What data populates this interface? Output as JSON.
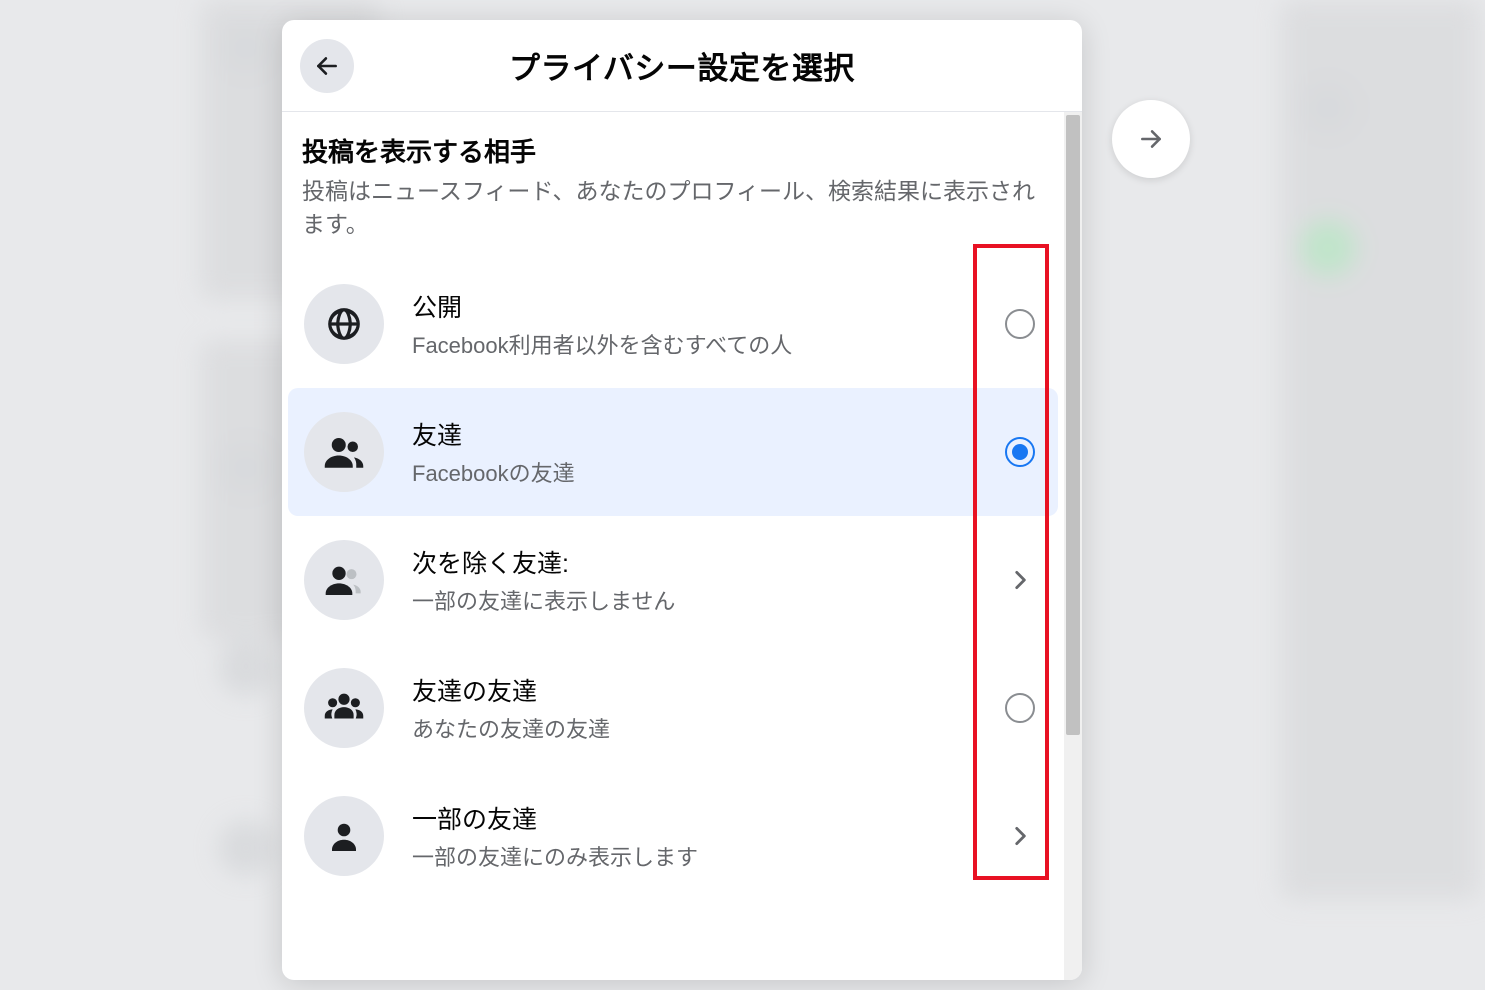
{
  "modal": {
    "title": "プライバシー設定を選択",
    "section_title": "投稿を表示する相手",
    "section_desc": "投稿はニュースフィード、あなたのプロフィール、検索結果に表示されます。"
  },
  "options": [
    {
      "icon": "globe",
      "label": "公開",
      "sub": "Facebook利用者以外を含むすべての人",
      "control": "radio",
      "selected": false
    },
    {
      "icon": "friends",
      "label": "友達",
      "sub": "Facebookの友達",
      "control": "radio",
      "selected": true
    },
    {
      "icon": "friends-except",
      "label": "次を除く友達:",
      "sub": "一部の友達に表示しません",
      "control": "chevron",
      "selected": false
    },
    {
      "icon": "friends-of",
      "label": "友達の友達",
      "sub": "あなたの友達の友達",
      "control": "radio",
      "selected": false
    },
    {
      "icon": "specific",
      "label": "一部の友達",
      "sub": "一部の友達にのみ表示します",
      "control": "chevron",
      "selected": false
    }
  ]
}
